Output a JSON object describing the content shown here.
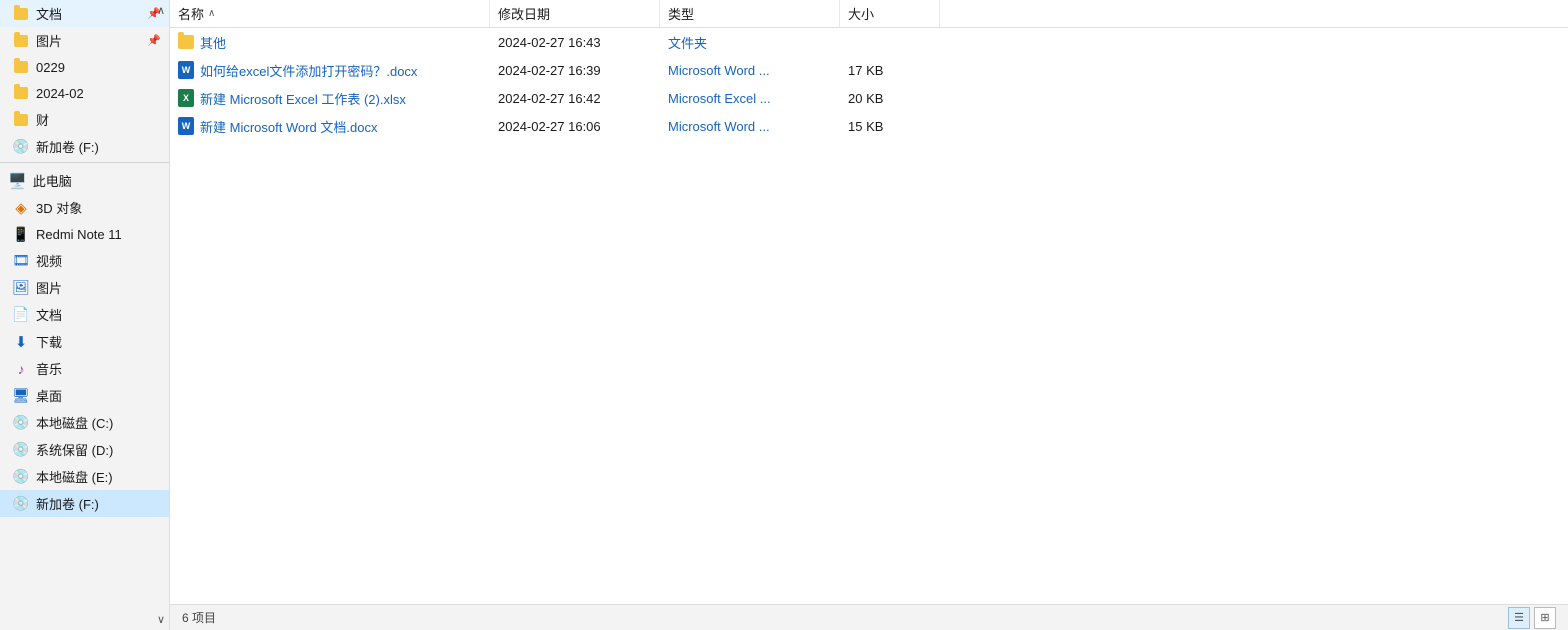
{
  "sidebar": {
    "items": [
      {
        "id": "documents",
        "label": "文档",
        "icon": "folder",
        "pinned": true
      },
      {
        "id": "pictures",
        "label": "图片",
        "icon": "folder",
        "pinned": true
      },
      {
        "id": "folder-0229",
        "label": "0229",
        "icon": "folder",
        "pinned": false
      },
      {
        "id": "folder-2024-02",
        "label": "2024-02",
        "icon": "folder",
        "pinned": false
      },
      {
        "id": "folder-cai",
        "label": "财",
        "icon": "folder",
        "pinned": false
      },
      {
        "id": "drive-f-top",
        "label": "新加卷 (F:)",
        "icon": "drive",
        "pinned": false
      }
    ],
    "this_pc": "此电脑",
    "pc_items": [
      {
        "id": "3d",
        "label": "3D 对象",
        "icon": "3d"
      },
      {
        "id": "redmi",
        "label": "Redmi Note 11",
        "icon": "phone"
      },
      {
        "id": "video",
        "label": "视频",
        "icon": "video"
      },
      {
        "id": "img",
        "label": "图片",
        "icon": "pictures"
      },
      {
        "id": "doc",
        "label": "文档",
        "icon": "docs"
      },
      {
        "id": "download",
        "label": "下载",
        "icon": "download"
      },
      {
        "id": "music",
        "label": "音乐",
        "icon": "music"
      },
      {
        "id": "desktop",
        "label": "桌面",
        "icon": "desktop"
      },
      {
        "id": "drive-c",
        "label": "本地磁盘 (C:)",
        "icon": "drive"
      },
      {
        "id": "drive-d",
        "label": "系统保留 (D:)",
        "icon": "drive"
      },
      {
        "id": "drive-e",
        "label": "本地磁盘 (E:)",
        "icon": "drive"
      },
      {
        "id": "drive-f",
        "label": "新加卷 (F:)",
        "icon": "drive",
        "active": true
      }
    ]
  },
  "columns": {
    "name": "名称",
    "modified": "修改日期",
    "type": "类型",
    "size": "大小"
  },
  "files": [
    {
      "name": "其他",
      "modified": "2024-02-27 16:43",
      "type": "文件夹",
      "size": "",
      "icon": "folder"
    },
    {
      "name": "如何给excel文件添加打开密码？.docx",
      "modified": "2024-02-27 16:39",
      "type": "Microsoft Word ...",
      "size": "17 KB",
      "icon": "word"
    },
    {
      "name": "新建 Microsoft Excel 工作表 (2).xlsx",
      "modified": "2024-02-27 16:42",
      "type": "Microsoft Excel ...",
      "size": "20 KB",
      "icon": "excel"
    },
    {
      "name": "新建 Microsoft Word 文档.docx",
      "modified": "2024-02-27 16:06",
      "type": "Microsoft Word ...",
      "size": "15 KB",
      "icon": "word"
    }
  ],
  "status": {
    "count": "6 项目"
  },
  "sort": {
    "arrow": "∧"
  }
}
